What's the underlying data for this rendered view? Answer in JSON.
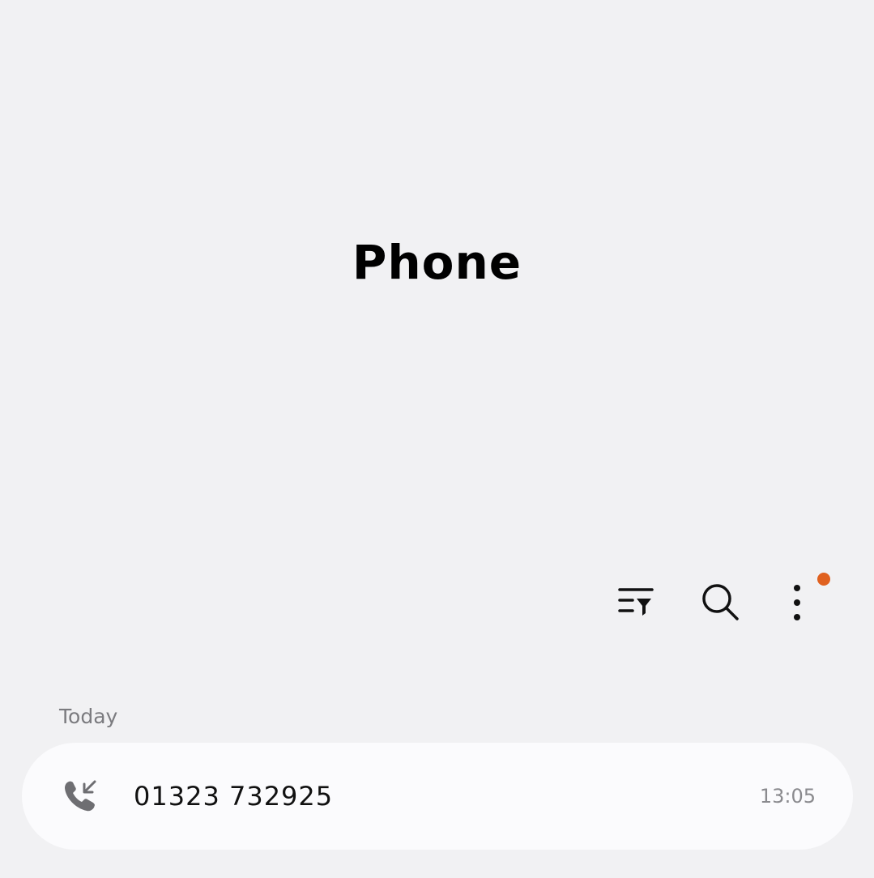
{
  "app": {
    "title": "Phone"
  },
  "toolbar": {
    "filter_icon": "filter-list-icon",
    "search_icon": "search-icon",
    "more_icon": "more-vertical-icon",
    "notification_dot_color": "#e0611f"
  },
  "recents": {
    "section_label": "Today",
    "calls": [
      {
        "type_icon": "incoming-call-icon",
        "number": "01323 732925",
        "time": "13:05"
      }
    ]
  }
}
